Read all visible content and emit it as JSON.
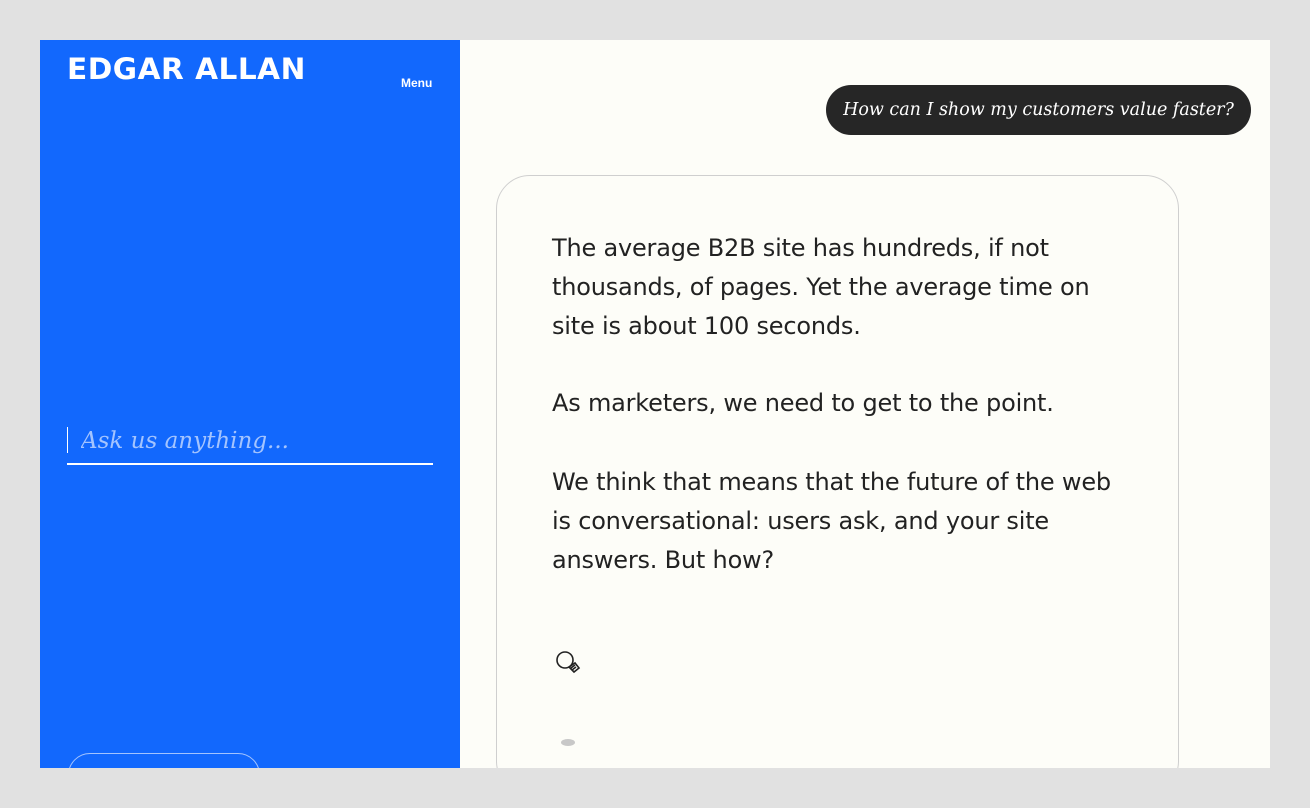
{
  "sidebar": {
    "logo": "EDGAR ALLAN",
    "menu_label": "Menu",
    "ask_placeholder": "Ask us anything..."
  },
  "conversation": {
    "question": "How can I show my customers value faster?",
    "answer": {
      "paragraphs": [
        "The average B2B site has hundreds, if not thousands, of pages. Yet the average time on site is about 100 seconds.",
        "As marketers, we need to get to the point.",
        "We think that means that the future of the web is conversational: users ask, and your site answers. But how?"
      ]
    },
    "icons": {
      "lightbulb": "lightbulb-icon",
      "loading": "loading-dot"
    }
  },
  "colors": {
    "sidebar_bg": "#1268fd",
    "main_bg": "#fdfdf8",
    "bubble_bg": "#262626",
    "text": "#222222",
    "placeholder": "#a4c4fe",
    "card_border": "#cfcfcf"
  }
}
